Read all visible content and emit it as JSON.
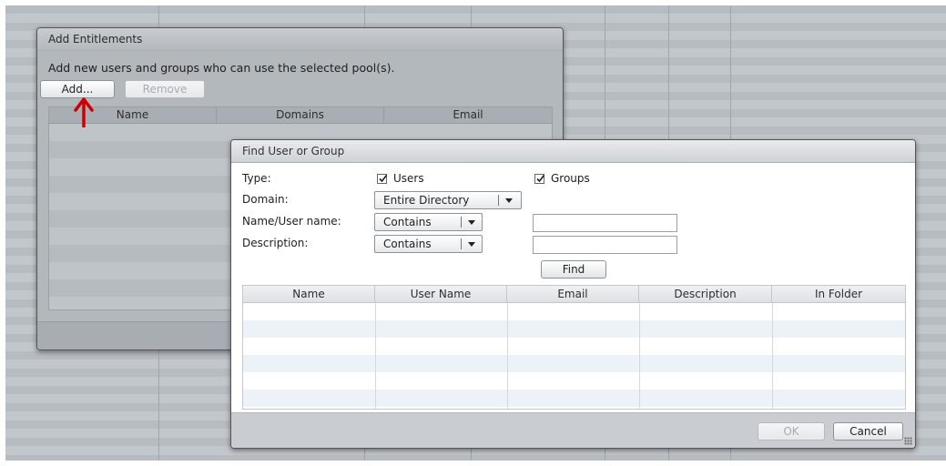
{
  "entitlements_dialog": {
    "title": "Add Entitlements",
    "description": "Add new users and groups who can use the selected pool(s).",
    "add_label": "Add...",
    "remove_label": "Remove",
    "columns": [
      "Name",
      "Domains",
      "Email"
    ]
  },
  "find_dialog": {
    "title": "Find User or Group",
    "type_label": "Type:",
    "users_label": "Users",
    "users_checked": true,
    "groups_label": "Groups",
    "groups_checked": true,
    "domain_label": "Domain:",
    "domain_value": "Entire Directory",
    "name_label": "Name/User name:",
    "name_match": "Contains",
    "name_value": "",
    "description_label": "Description:",
    "description_match": "Contains",
    "description_value": "",
    "find_label": "Find",
    "columns": [
      "Name",
      "User Name",
      "Email",
      "Description",
      "In Folder"
    ],
    "ok_label": "OK",
    "cancel_label": "Cancel"
  },
  "colors": {
    "arrow": "#cc0000",
    "overlay": "#b9bec2",
    "row_alt": "#edf2f8"
  },
  "icons": {
    "annotation_arrow": "red-up-arrow",
    "checkbox": "checkmark-icon",
    "dropdown": "chevron-down-icon",
    "resize": "resize-grip-icon"
  }
}
